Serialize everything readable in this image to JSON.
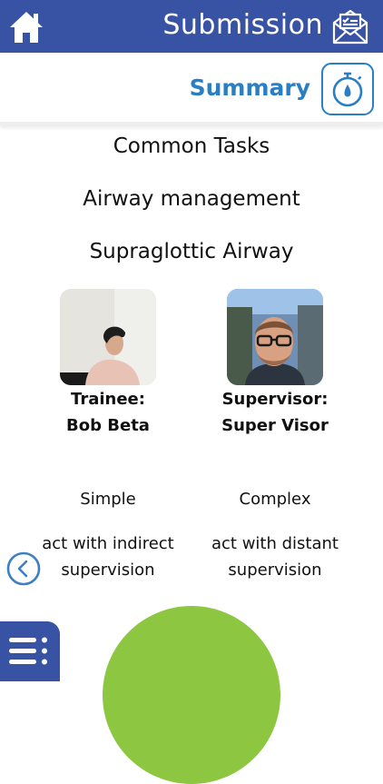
{
  "header": {
    "title": "Submission",
    "home_icon": "home-icon",
    "submission_icon": "envelope-check-icon"
  },
  "summary": {
    "label": "Summary",
    "timer_icon": "stopwatch-icon",
    "accent": "#2a7fc4"
  },
  "task": {
    "category": "Common Tasks",
    "subcategory": "Airway management",
    "procedure": "Supraglottic Airway"
  },
  "trainee": {
    "role": "Trainee:",
    "name": "Bob Beta",
    "complexity": "Simple",
    "entrustment_line1": "act with indirect",
    "entrustment_line2": "supervision"
  },
  "supervisor": {
    "role": "Supervisor:",
    "name": "Super Visor",
    "complexity": "Complex",
    "entrustment_line1": "act with distant",
    "entrustment_line2": "supervision"
  },
  "nav": {
    "back_icon": "chevron-left-circle-icon",
    "menu_icon": "menu-list-icon"
  },
  "colors": {
    "brand": "#3853a3",
    "dome": "#8dc641"
  }
}
